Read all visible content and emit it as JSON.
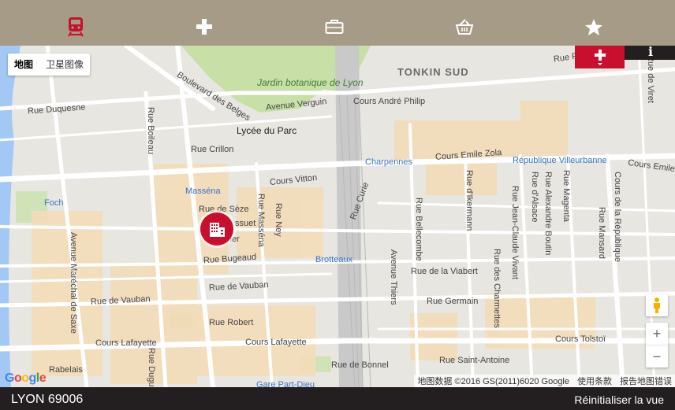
{
  "top_categories": [
    {
      "icon": "train-icon",
      "color": "#c8102e",
      "active": true
    },
    {
      "icon": "medical-cross-icon",
      "color": "#ffffff",
      "active": false
    },
    {
      "icon": "briefcase-icon",
      "color": "#ffffff",
      "active": false
    },
    {
      "icon": "shopping-basket-icon",
      "color": "#ffffff",
      "active": false
    },
    {
      "icon": "star-icon",
      "color": "#ffffff",
      "active": false
    }
  ],
  "map": {
    "type_control": {
      "map_label": "地图",
      "satellite_label": "卫星图像"
    },
    "add_button": {
      "icon": "plus-icon"
    },
    "info_button": {
      "label": "i"
    },
    "zoom": {
      "in": "+",
      "out": "−"
    },
    "labels": {
      "tonkin": "TONKIN SUD",
      "jardin": "Jardin botanique de Lyon",
      "boulevard_belges": "Boulevard des Belges",
      "avenue_verguin": "Avenue Verguin",
      "cours_andre_philip": "Cours André Philip",
      "rue_duquesne": "Rue Duquesne",
      "rue_boileau": "Rue Boileau",
      "lycee": "Lycée du Parc",
      "rue_crillon": "Rue Crillon",
      "cours_vitton": "Cours Vitton",
      "massena_station": "Masséna",
      "foch_station": "Foch",
      "rue_seze": "Rue de Sèze",
      "rue_massena": "Rue Masséna",
      "rue_ney": "Rue Ney",
      "rue_bugeaud": "Rue Bugeaud",
      "rue_vauban_1": "Rue de Vauban",
      "rue_vauban_2": "Rue de Vauban",
      "rue_robert": "Rue Robert",
      "cours_lafayette_1": "Cours Lafayette",
      "cours_lafayette_2": "Cours Lafayette",
      "cours_lafayette_3": "Cours Lafayette",
      "avenue_marechal": "Avenue Maréchal de Saxe",
      "rue_curie": "Rue Curie",
      "rue_bellecombe": "Rue Bellecombe",
      "rue_ikermann": "Rue d'Ikermann",
      "charpennes_station": "Charpennes",
      "cours_emile_zola": "Cours Emile Zola",
      "republique_station": "République Villeurbanne",
      "cours_emile_zola_2": "Cours Emile",
      "brotteaux_station": "Brotteaux",
      "avenue_thiers": "Avenue Thiers",
      "rue_viabert": "Rue de la Viabert",
      "rue_germain": "Rue Germain",
      "rue_bonnel": "Rue de Bonnel",
      "rue_saint_antoine": "Rue Saint-Antoine",
      "cours_tolstoi": "Cours Tolstoï",
      "rue_charmettes": "Rue des Charmettes",
      "rue_jean_claude_vivant": "Rue Jean-Claude Vivant",
      "rue_alexandre_boutin": "Rue Alexandre Boutin",
      "rue_alsace": "Rue d'Alsace",
      "rue_magenta": "Rue Magenta",
      "rue_mansard": "Rue Mansard",
      "cours_republique": "Cours de la République",
      "gare_part_dieu": "Gare Part-Dieu",
      "rue_dugue": "Rue Dugu",
      "rue_zabelais": "Rabelais",
      "rue_ro": "Rue Ro",
      "rue_de_viret": "Rue de Viret",
      "bosquet_text": "ssuet",
      "crier_text": "vier"
    },
    "attribution": {
      "data": "地图数据 ©2016 GS(2011)6020 Google",
      "terms": "使用条款",
      "report": "报告地图错误"
    },
    "google_logo": "Google"
  },
  "footer": {
    "address": "LYON 69006",
    "reset": "Réinitialiser la vue"
  },
  "colors": {
    "topbar": "#a69b86",
    "accent_red": "#c8102e",
    "footer_bg": "#231f20"
  }
}
